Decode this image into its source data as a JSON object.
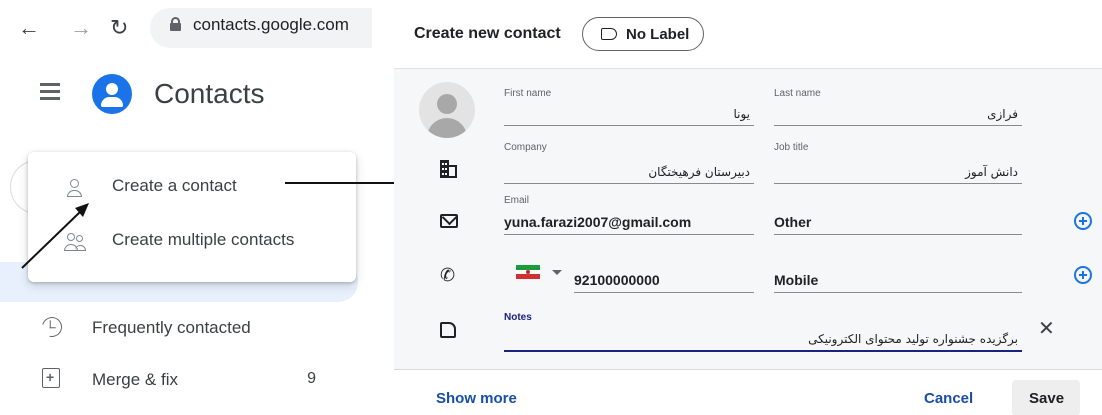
{
  "browser": {
    "url": "contacts.google.com"
  },
  "app": {
    "title": "Contacts"
  },
  "create_menu": {
    "items": [
      {
        "label": "Create a contact",
        "icon": "person-outline-icon"
      },
      {
        "label": "Create multiple contacts",
        "icon": "people-outline-icon"
      }
    ]
  },
  "sidebar": {
    "items": [
      {
        "label": "Frequently contacted",
        "icon": "history-icon",
        "count": ""
      },
      {
        "label": "Merge & fix",
        "icon": "merge-icon",
        "count": "9"
      }
    ]
  },
  "dialog": {
    "title": "Create new contact",
    "label_chip": "No Label",
    "fields": {
      "first_name": {
        "label": "First name",
        "value": "یونا"
      },
      "last_name": {
        "label": "Last name",
        "value": "فرازی"
      },
      "company": {
        "label": "Company",
        "value": "دبیرستان فرهیختگان"
      },
      "job_title": {
        "label": "Job title",
        "value": "دانش آموز"
      },
      "email": {
        "label": "Email",
        "value": "yuna.farazi2007@gmail.com"
      },
      "email_type": {
        "value": "Other"
      },
      "phone": {
        "value": "92100000000"
      },
      "phone_type": {
        "value": "Mobile"
      },
      "notes": {
        "label": "Notes",
        "value": "برگزیده جشنواره تولید محتوای الکترونیکی"
      }
    },
    "buttons": {
      "show_more": "Show more",
      "cancel": "Cancel",
      "save": "Save"
    }
  },
  "colors": {
    "accent": "#1a73e8",
    "link": "#174ea6",
    "notes_underline": "#1a237e"
  }
}
